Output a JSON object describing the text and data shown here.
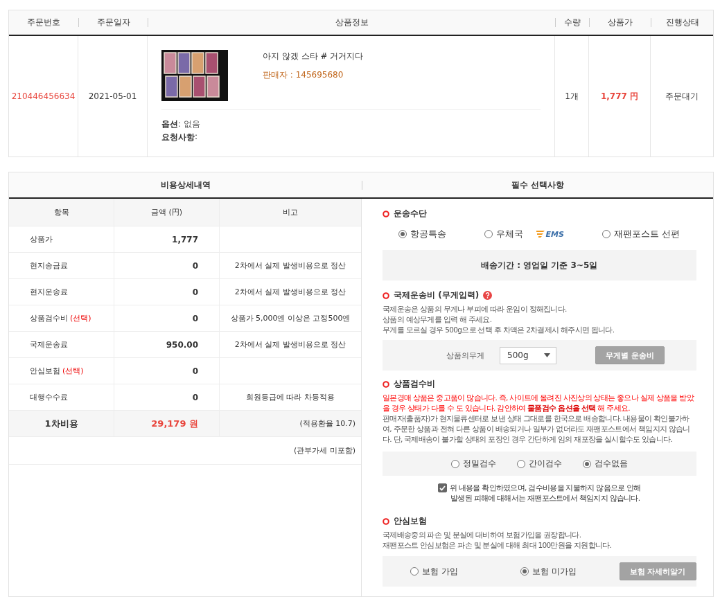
{
  "order_table": {
    "columns": [
      "주문번호",
      "주문일자",
      "상품정보",
      "수량",
      "상품가",
      "진행상태"
    ],
    "row": {
      "order_no": "210446456634",
      "date": "2021-05-01",
      "product": {
        "title": "아지 않겠 스타 # 거거지다",
        "seller": "판매자 : 145695680",
        "option_label": "옵션",
        "option_value": " : 없음",
        "request_label": "요청사항",
        "request_value": " :"
      },
      "quantity": "1개",
      "price": "1,777 円",
      "status": "주문대기"
    }
  },
  "cost_panel": {
    "title": "비용상세내역",
    "columns": [
      "항목",
      "금액 (円)",
      "비고"
    ],
    "rows": [
      {
        "item": "상품가",
        "amount": "1,777",
        "note": ""
      },
      {
        "item": "현지송금료",
        "amount": "0",
        "note": "2차에서 실제 발생비용으로 정산"
      },
      {
        "item": "현지운송료",
        "amount": "0",
        "note": "2차에서 실제 발생비용으로 정산"
      },
      {
        "item": "상품검수비",
        "tag": "(선택)",
        "amount": "0",
        "note": "상품가 5,000엔 이상은 고정500엔"
      },
      {
        "item": "국제운송료",
        "amount": "950.00",
        "note": "2차에서 실제 발생비용으로 정산"
      },
      {
        "item": "안심보험",
        "tag": "(선택)",
        "amount": "0",
        "note": ""
      },
      {
        "item": "대행수수료",
        "amount": "0",
        "note": "회원등급에 따라 차등적용"
      }
    ],
    "total": {
      "label": "1차비용",
      "amount": "29,179 원",
      "note": "(적용환율 10.7)"
    },
    "footnote": "(관부가세 미포함)"
  },
  "options_panel": {
    "title": "필수 선택사항",
    "shipping": {
      "title": "운송수단",
      "options": [
        {
          "label": "항공특송",
          "selected": true
        },
        {
          "label": "우체국",
          "logo_text": "EMS",
          "selected": false
        },
        {
          "label": "재팬포스트 선편",
          "selected": false
        }
      ],
      "period": "배송기간 : 영업일 기준 3~5일"
    },
    "intl_fee": {
      "title": "국제운송비 (무게입력)",
      "lines": [
        "국제운송은 상품의 무게나 부피에 따라 운임이 정해집니다.",
        "상품의 예상무게를 입력 해 주세요.",
        "무게를 모르실 경우 500g으로 선택 후 차액은 2차결제시 해주시면 됩니다."
      ],
      "weight_label": "상품의무게",
      "weight_value": "500g",
      "button": "무게별 운송비"
    },
    "inspection": {
      "title": "상품검수비",
      "warning": "일본경매 상품은 중고품이 많습니다. 즉, 사이트에 올려진 사진상의 상태는 좋으나 실제 상품을 받았을 경우 상태가 다를 수 도 있습니다. 감안하여 **물품검수 옵션을 선택** 해 주세요.",
      "description": "판매자(출품자)가 현지물류센터로 보낸 상태 그대로를 한국으로 배송합니다. 내용물이 확인불가하여, 주문한 상품과 전혀 다른 상품이 배송되거나 일부가 없더라도 재팬포스트에서 책임지지 않습니다. 단, 국제배송이 불가할 상태의 포장인 경우 간단하게 임의 재포장을 실시할수도 있습니다.",
      "options": [
        {
          "label": "정밀검수",
          "selected": false
        },
        {
          "label": "간이검수",
          "selected": false
        },
        {
          "label": "검수없음",
          "selected": true
        }
      ],
      "consent": {
        "checked": true,
        "lines": [
          "위 내용을 확인하였으며, 검수비용을 지불하지 않음으로 인해",
          "발생된 피해에 대해서는 재팬포스트에서 책임지지 않습니다."
        ]
      }
    },
    "insurance": {
      "title": "안심보험",
      "lines": [
        "국제배송중의 파손 및 분실에 대비하여 보험가입을 권장합니다.",
        "재팬포스트 안심보험은 파손 및 분실에 대해 최대 100만원을 지원합니다."
      ],
      "options": [
        {
          "label": "보험 가입",
          "selected": false
        },
        {
          "label": "보험 미가입",
          "selected": true
        }
      ],
      "button": "보험 자세히알기"
    }
  }
}
